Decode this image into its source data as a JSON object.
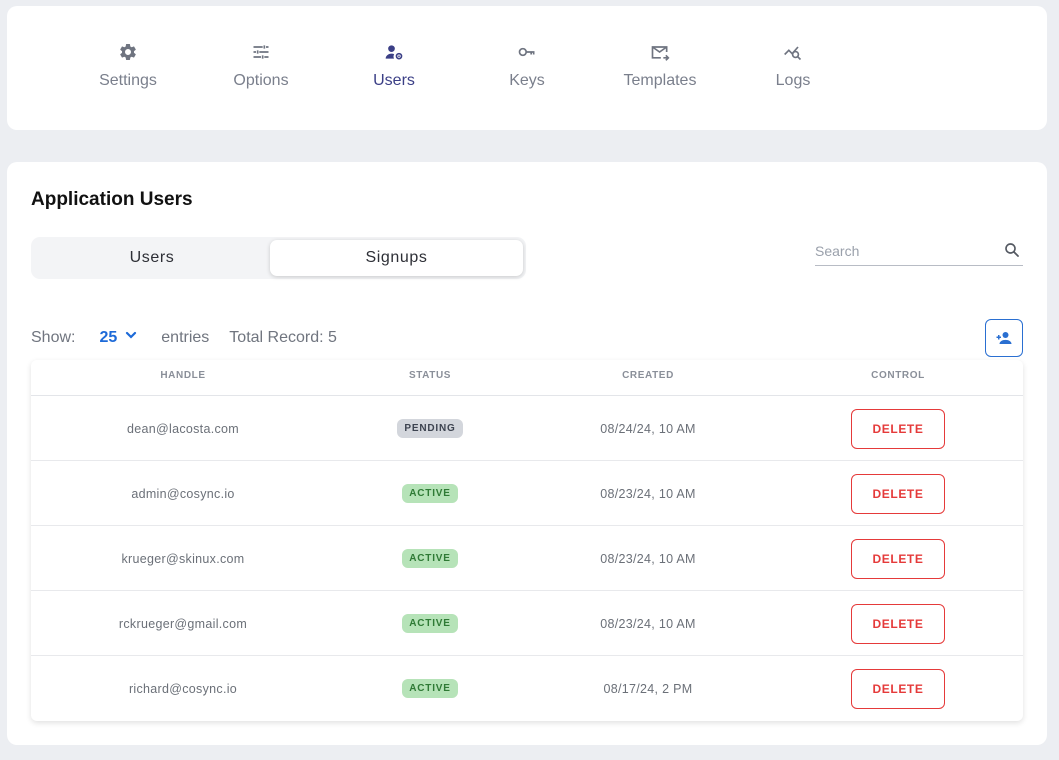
{
  "nav": {
    "items": [
      {
        "label": "Settings",
        "icon": "gear-icon"
      },
      {
        "label": "Options",
        "icon": "sliders-icon"
      },
      {
        "label": "Users",
        "icon": "user-gear-icon",
        "active": true
      },
      {
        "label": "Keys",
        "icon": "key-icon"
      },
      {
        "label": "Templates",
        "icon": "mail-forward-icon"
      },
      {
        "label": "Logs",
        "icon": "chart-search-icon"
      }
    ],
    "active_color": "#3b3f86",
    "inactive_color": "#7a7f8c"
  },
  "page": {
    "title": "Application Users"
  },
  "segmented": {
    "users_label": "Users",
    "signups_label": "Signups",
    "selected": "Signups"
  },
  "search": {
    "placeholder": "Search",
    "value": "",
    "icon": "search-icon"
  },
  "list_controls": {
    "show_label": "Show:",
    "page_size": "25",
    "entries_label": "entries",
    "total_label": "Total Record: 5",
    "add_icon": "add-user-icon"
  },
  "table": {
    "headers": {
      "handle": "HANDLE",
      "status": "STATUS",
      "created": "CREATED",
      "control": "CONTROL"
    },
    "rows": [
      {
        "handle": "dean@lacosta.com",
        "status": "PENDING",
        "created": "08/24/24, 10 AM",
        "action": "DELETE"
      },
      {
        "handle": "admin@cosync.io",
        "status": "ACTIVE",
        "created": "08/23/24, 10 AM",
        "action": "DELETE"
      },
      {
        "handle": "krueger@skinux.com",
        "status": "ACTIVE",
        "created": "08/23/24, 10 AM",
        "action": "DELETE"
      },
      {
        "handle": "rckrueger@gmail.com",
        "status": "ACTIVE",
        "created": "08/23/24, 10 AM",
        "action": "DELETE"
      },
      {
        "handle": "richard@cosync.io",
        "status": "ACTIVE",
        "created": "08/17/24, 2 PM",
        "action": "DELETE"
      }
    ]
  },
  "colors": {
    "accent_blue": "#1d6ad8",
    "danger_red": "#e53a3a",
    "active_green_bg": "#b6e3b8",
    "pending_gray_bg": "#d3d6dc"
  }
}
